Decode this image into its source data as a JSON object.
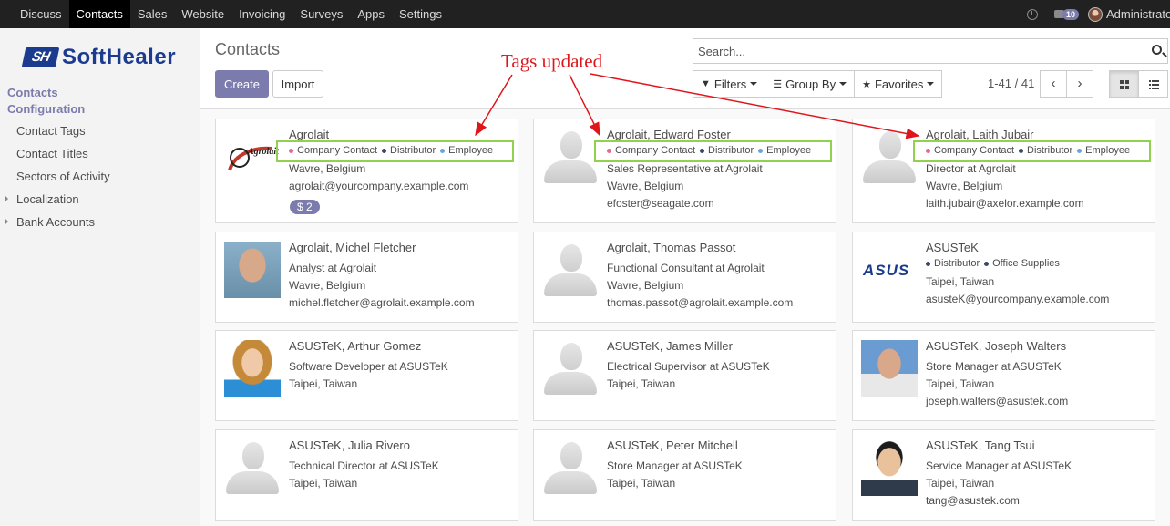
{
  "topbar": {
    "menu": [
      "Discuss",
      "Contacts",
      "Sales",
      "Website",
      "Invoicing",
      "Surveys",
      "Apps",
      "Settings"
    ],
    "active": "Contacts",
    "chat_count": "10",
    "user": "Administrator"
  },
  "sidebar": {
    "logo_mark": "SH",
    "logo_text": "SoftHealer",
    "section1": "Contacts",
    "section2": "Configuration",
    "items": [
      {
        "label": "Contact Tags",
        "expandable": false
      },
      {
        "label": "Contact Titles",
        "expandable": false
      },
      {
        "label": "Sectors of Activity",
        "expandable": false
      },
      {
        "label": "Localization",
        "expandable": true
      },
      {
        "label": "Bank Accounts",
        "expandable": true
      }
    ]
  },
  "control": {
    "title": "Contacts",
    "create": "Create",
    "import": "Import",
    "search_placeholder": "Search...",
    "filters": "Filters",
    "group_by": "Group By",
    "favorites": "Favorites",
    "pager": "1-41 / 41"
  },
  "annotation": "Tags updated",
  "colors": {
    "accent": "#7c7bad",
    "tag_company_contact": "#e06c8a",
    "tag_distributor": "#3d4866",
    "tag_employee": "#6aa5d8",
    "tag_office_supplies": "#3d4866",
    "highlight": "#92d050",
    "annotation": "#e0151c"
  },
  "cards": [
    {
      "name": "Agrolait",
      "image": "agrolait-logo",
      "logo_text": "Agrolait",
      "tags": [
        "Company Contact",
        "Distributor",
        "Employee"
      ],
      "lines": [
        "Wavre, Belgium",
        "agrolait@yourcompany.example.com"
      ],
      "badge": "$ 2"
    },
    {
      "name": "Agrolait, Edward Foster",
      "image": "placeholder",
      "tags": [
        "Company Contact",
        "Distributor",
        "Employee"
      ],
      "lines": [
        "Sales Representative at Agrolait",
        "Wavre, Belgium",
        "efoster@seagate.com"
      ]
    },
    {
      "name": "Agrolait, Laith Jubair",
      "image": "placeholder",
      "tags": [
        "Company Contact",
        "Distributor",
        "Employee"
      ],
      "lines": [
        "Director at Agrolait",
        "Wavre, Belgium",
        "laith.jubair@axelor.example.com"
      ]
    },
    {
      "name": "Agrolait, Michel Fletcher",
      "image": "photo-man-1",
      "tags": [],
      "lines": [
        "Analyst at Agrolait",
        "Wavre, Belgium",
        "michel.fletcher@agrolait.example.com"
      ]
    },
    {
      "name": "Agrolait, Thomas Passot",
      "image": "placeholder",
      "tags": [],
      "lines": [
        "Functional Consultant at Agrolait",
        "Wavre, Belgium",
        "thomas.passot@agrolait.example.com"
      ]
    },
    {
      "name": "ASUSTeK",
      "image": "asus-logo",
      "logo_text": "ASUS",
      "tags": [
        "Distributor",
        "Office Supplies"
      ],
      "lines": [
        "Taipei, Taiwan",
        "asusteK@yourcompany.example.com"
      ]
    },
    {
      "name": "ASUSTeK, Arthur Gomez",
      "image": "photo-woman",
      "tags": [],
      "lines": [
        "Software Developer at ASUSTeK",
        "Taipei, Taiwan"
      ]
    },
    {
      "name": "ASUSTeK, James Miller",
      "image": "placeholder",
      "tags": [],
      "lines": [
        "Electrical Supervisor at ASUSTeK",
        "Taipei, Taiwan"
      ]
    },
    {
      "name": "ASUSTeK, Joseph Walters",
      "image": "photo-man-2",
      "tags": [],
      "lines": [
        "Store Manager at ASUSTeK",
        "Taipei, Taiwan",
        "joseph.walters@asustek.com"
      ]
    },
    {
      "name": "ASUSTeK, Julia Rivero",
      "image": "placeholder",
      "tags": [],
      "lines": [
        "Technical Director at ASUSTeK",
        "Taipei, Taiwan"
      ]
    },
    {
      "name": "ASUSTeK, Peter Mitchell",
      "image": "placeholder",
      "tags": [],
      "lines": [
        "Store Manager at ASUSTeK",
        "Taipei, Taiwan"
      ]
    },
    {
      "name": "ASUSTeK, Tang Tsui",
      "image": "photo-man-3",
      "tags": [],
      "lines": [
        "Service Manager at ASUSTeK",
        "Taipei, Taiwan",
        "tang@asustek.com"
      ]
    }
  ]
}
